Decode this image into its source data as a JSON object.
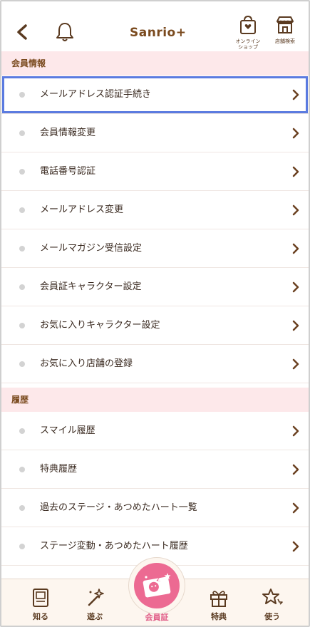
{
  "header": {
    "logo": "Sanrio+",
    "online_shop_label_1": "オンライン",
    "online_shop_label_2": "ショップ",
    "store_search_label": "店舗検索"
  },
  "sections": [
    {
      "title": "会員情報",
      "items": [
        {
          "label": "メールアドレス認証手続き"
        },
        {
          "label": "会員情報変更"
        },
        {
          "label": "電話番号認証"
        },
        {
          "label": "メールアドレス変更"
        },
        {
          "label": "メールマガジン受信設定"
        },
        {
          "label": "会員証キャラクター設定"
        },
        {
          "label": "お気に入りキャラクター設定"
        },
        {
          "label": "お気に入り店舗の登録"
        }
      ]
    },
    {
      "title": "履歴",
      "items": [
        {
          "label": "スマイル履歴"
        },
        {
          "label": "特典履歴"
        },
        {
          "label": "過去のステージ・あつめたハート一覧"
        },
        {
          "label": "ステージ変動・あつめたハート履歴"
        }
      ]
    }
  ],
  "tabbar": {
    "tabs": [
      {
        "label": "知る",
        "icon": "book-icon"
      },
      {
        "label": "遊ぶ",
        "icon": "magic-wand-icon"
      },
      {
        "label": "会員証",
        "icon": "member-card-icon"
      },
      {
        "label": "特典",
        "icon": "gift-icon"
      },
      {
        "label": "使う",
        "icon": "star-icon"
      }
    ]
  },
  "colors": {
    "accent": "#ec6a92",
    "brand_brown": "#7a4a1e",
    "section_bg": "#fde8ea",
    "highlight_outline": "#5b7be0"
  }
}
